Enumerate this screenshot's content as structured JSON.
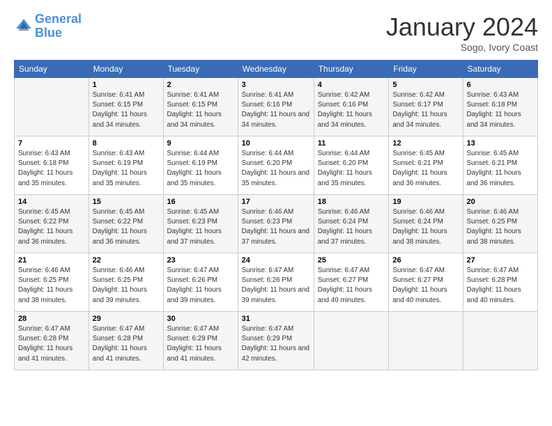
{
  "logo": {
    "line1": "General",
    "line2": "Blue"
  },
  "title": "January 2024",
  "subtitle": "Sogo, Ivory Coast",
  "days_header": [
    "Sunday",
    "Monday",
    "Tuesday",
    "Wednesday",
    "Thursday",
    "Friday",
    "Saturday"
  ],
  "weeks": [
    [
      {
        "day": "",
        "sunrise": "",
        "sunset": "",
        "daylight": ""
      },
      {
        "day": "1",
        "sunrise": "Sunrise: 6:41 AM",
        "sunset": "Sunset: 6:15 PM",
        "daylight": "Daylight: 11 hours and 34 minutes."
      },
      {
        "day": "2",
        "sunrise": "Sunrise: 6:41 AM",
        "sunset": "Sunset: 6:15 PM",
        "daylight": "Daylight: 11 hours and 34 minutes."
      },
      {
        "day": "3",
        "sunrise": "Sunrise: 6:41 AM",
        "sunset": "Sunset: 6:16 PM",
        "daylight": "Daylight: 11 hours and 34 minutes."
      },
      {
        "day": "4",
        "sunrise": "Sunrise: 6:42 AM",
        "sunset": "Sunset: 6:16 PM",
        "daylight": "Daylight: 11 hours and 34 minutes."
      },
      {
        "day": "5",
        "sunrise": "Sunrise: 6:42 AM",
        "sunset": "Sunset: 6:17 PM",
        "daylight": "Daylight: 11 hours and 34 minutes."
      },
      {
        "day": "6",
        "sunrise": "Sunrise: 6:43 AM",
        "sunset": "Sunset: 6:18 PM",
        "daylight": "Daylight: 11 hours and 34 minutes."
      }
    ],
    [
      {
        "day": "7",
        "sunrise": "Sunrise: 6:43 AM",
        "sunset": "Sunset: 6:18 PM",
        "daylight": "Daylight: 11 hours and 35 minutes."
      },
      {
        "day": "8",
        "sunrise": "Sunrise: 6:43 AM",
        "sunset": "Sunset: 6:19 PM",
        "daylight": "Daylight: 11 hours and 35 minutes."
      },
      {
        "day": "9",
        "sunrise": "Sunrise: 6:44 AM",
        "sunset": "Sunset: 6:19 PM",
        "daylight": "Daylight: 11 hours and 35 minutes."
      },
      {
        "day": "10",
        "sunrise": "Sunrise: 6:44 AM",
        "sunset": "Sunset: 6:20 PM",
        "daylight": "Daylight: 11 hours and 35 minutes."
      },
      {
        "day": "11",
        "sunrise": "Sunrise: 6:44 AM",
        "sunset": "Sunset: 6:20 PM",
        "daylight": "Daylight: 11 hours and 35 minutes."
      },
      {
        "day": "12",
        "sunrise": "Sunrise: 6:45 AM",
        "sunset": "Sunset: 6:21 PM",
        "daylight": "Daylight: 11 hours and 36 minutes."
      },
      {
        "day": "13",
        "sunrise": "Sunrise: 6:45 AM",
        "sunset": "Sunset: 6:21 PM",
        "daylight": "Daylight: 11 hours and 36 minutes."
      }
    ],
    [
      {
        "day": "14",
        "sunrise": "Sunrise: 6:45 AM",
        "sunset": "Sunset: 6:22 PM",
        "daylight": "Daylight: 11 hours and 36 minutes."
      },
      {
        "day": "15",
        "sunrise": "Sunrise: 6:45 AM",
        "sunset": "Sunset: 6:22 PM",
        "daylight": "Daylight: 11 hours and 36 minutes."
      },
      {
        "day": "16",
        "sunrise": "Sunrise: 6:45 AM",
        "sunset": "Sunset: 6:23 PM",
        "daylight": "Daylight: 11 hours and 37 minutes."
      },
      {
        "day": "17",
        "sunrise": "Sunrise: 6:46 AM",
        "sunset": "Sunset: 6:23 PM",
        "daylight": "Daylight: 11 hours and 37 minutes."
      },
      {
        "day": "18",
        "sunrise": "Sunrise: 6:46 AM",
        "sunset": "Sunset: 6:24 PM",
        "daylight": "Daylight: 11 hours and 37 minutes."
      },
      {
        "day": "19",
        "sunrise": "Sunrise: 6:46 AM",
        "sunset": "Sunset: 6:24 PM",
        "daylight": "Daylight: 11 hours and 38 minutes."
      },
      {
        "day": "20",
        "sunrise": "Sunrise: 6:46 AM",
        "sunset": "Sunset: 6:25 PM",
        "daylight": "Daylight: 11 hours and 38 minutes."
      }
    ],
    [
      {
        "day": "21",
        "sunrise": "Sunrise: 6:46 AM",
        "sunset": "Sunset: 6:25 PM",
        "daylight": "Daylight: 11 hours and 38 minutes."
      },
      {
        "day": "22",
        "sunrise": "Sunrise: 6:46 AM",
        "sunset": "Sunset: 6:25 PM",
        "daylight": "Daylight: 11 hours and 39 minutes."
      },
      {
        "day": "23",
        "sunrise": "Sunrise: 6:47 AM",
        "sunset": "Sunset: 6:26 PM",
        "daylight": "Daylight: 11 hours and 39 minutes."
      },
      {
        "day": "24",
        "sunrise": "Sunrise: 6:47 AM",
        "sunset": "Sunset: 6:26 PM",
        "daylight": "Daylight: 11 hours and 39 minutes."
      },
      {
        "day": "25",
        "sunrise": "Sunrise: 6:47 AM",
        "sunset": "Sunset: 6:27 PM",
        "daylight": "Daylight: 11 hours and 40 minutes."
      },
      {
        "day": "26",
        "sunrise": "Sunrise: 6:47 AM",
        "sunset": "Sunset: 6:27 PM",
        "daylight": "Daylight: 11 hours and 40 minutes."
      },
      {
        "day": "27",
        "sunrise": "Sunrise: 6:47 AM",
        "sunset": "Sunset: 6:28 PM",
        "daylight": "Daylight: 11 hours and 40 minutes."
      }
    ],
    [
      {
        "day": "28",
        "sunrise": "Sunrise: 6:47 AM",
        "sunset": "Sunset: 6:28 PM",
        "daylight": "Daylight: 11 hours and 41 minutes."
      },
      {
        "day": "29",
        "sunrise": "Sunrise: 6:47 AM",
        "sunset": "Sunset: 6:28 PM",
        "daylight": "Daylight: 11 hours and 41 minutes."
      },
      {
        "day": "30",
        "sunrise": "Sunrise: 6:47 AM",
        "sunset": "Sunset: 6:29 PM",
        "daylight": "Daylight: 11 hours and 41 minutes."
      },
      {
        "day": "31",
        "sunrise": "Sunrise: 6:47 AM",
        "sunset": "Sunset: 6:29 PM",
        "daylight": "Daylight: 11 hours and 42 minutes."
      },
      {
        "day": "",
        "sunrise": "",
        "sunset": "",
        "daylight": ""
      },
      {
        "day": "",
        "sunrise": "",
        "sunset": "",
        "daylight": ""
      },
      {
        "day": "",
        "sunrise": "",
        "sunset": "",
        "daylight": ""
      }
    ]
  ]
}
